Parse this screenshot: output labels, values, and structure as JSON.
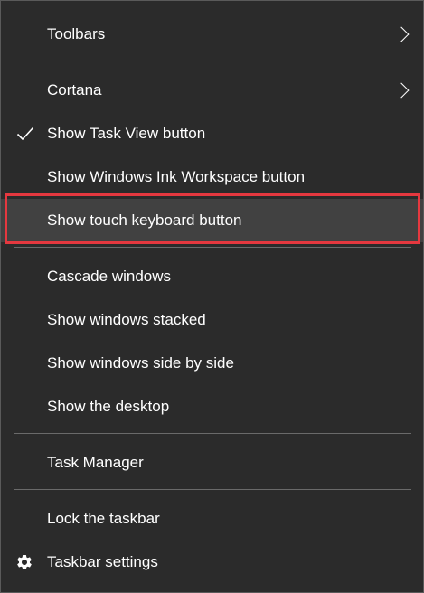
{
  "menu": {
    "items": [
      {
        "label": "Toolbars",
        "submenu": true
      },
      {
        "label": "Cortana",
        "submenu": true
      },
      {
        "label": "Show Task View button",
        "checked": true
      },
      {
        "label": "Show Windows Ink Workspace button"
      },
      {
        "label": "Show touch keyboard button",
        "highlighted": true
      },
      {
        "label": "Cascade windows"
      },
      {
        "label": "Show windows stacked"
      },
      {
        "label": "Show windows side by side"
      },
      {
        "label": "Show the desktop"
      },
      {
        "label": "Task Manager"
      },
      {
        "label": "Lock the taskbar"
      },
      {
        "label": "Taskbar settings",
        "icon": "gear-icon"
      }
    ]
  },
  "colors": {
    "background": "#2b2b2b",
    "highlight_background": "#414141",
    "highlight_border": "#e5383f",
    "separator": "#6a6a6a",
    "text": "#ffffff"
  }
}
